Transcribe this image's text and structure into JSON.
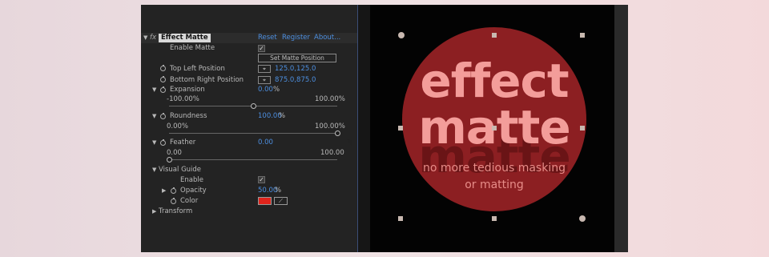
{
  "effect": {
    "fx_symbol": "fx",
    "title": "Effect Matte",
    "reset": "Reset",
    "register": "Register",
    "about": "About..."
  },
  "params": {
    "enable_matte": "Enable Matte",
    "set_matte_position": "Set Matte Position",
    "top_left_position": "Top Left Position",
    "top_left_value": "125.0,125.0",
    "bottom_right_position": "Bottom Right Position",
    "bottom_right_value": "875.0,875.0",
    "expansion": "Expansion",
    "expansion_value": "0.00",
    "expansion_unit": "%",
    "expansion_min": "-100.00%",
    "expansion_max": "100.00%",
    "expansion_level": 0.5,
    "roundness": "Roundness",
    "roundness_value": "100.00",
    "roundness_unit": "%",
    "roundness_min": "0.00%",
    "roundness_max": "100.00%",
    "roundness_level": 1.0,
    "feather": "Feather",
    "feather_value": "0.00",
    "feather_min": "0.00",
    "feather_max": "100.00",
    "feather_level": 0.0,
    "visual_guide": "Visual Guide",
    "enable": "Enable",
    "opacity": "Opacity",
    "opacity_value": "50.00",
    "opacity_unit": "%",
    "color": "Color",
    "color_value": "#e0241c",
    "transform": "Transform"
  },
  "viewer": {
    "line1": "effect",
    "line2": "matte",
    "ghost": "matte",
    "sub1": "no more tedious masking",
    "sub2": "or matting"
  },
  "colors": {
    "link_blue": "#4d8fe0",
    "circle_red": "#8c1f22",
    "text_pink": "#f39d9a"
  }
}
